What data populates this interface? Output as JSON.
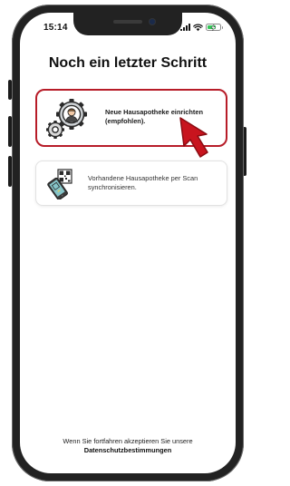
{
  "status_bar": {
    "time": "15:14",
    "icons": [
      "signal-icon",
      "wifi-icon",
      "battery-charging-icon"
    ],
    "battery_color": "#34c759",
    "battery_level": 0.7
  },
  "page": {
    "title": "Noch ein letzter Schritt"
  },
  "options": [
    {
      "label": "Neue Hausapotheke einrichten (empfohlen).",
      "icon": "gear-person-icon",
      "highlighted": true,
      "highlight_color": "#b71c28"
    },
    {
      "label": "Vorhandene Hausapotheke per Scan synchronisieren.",
      "icon": "qr-scan-phone-icon",
      "highlighted": false
    }
  ],
  "annotation": {
    "icon": "red-arrow-cursor-icon",
    "color": "#c8141e"
  },
  "footer": {
    "consent_text": "Wenn Sie fortfahren akzeptieren Sie unsere",
    "privacy_link": "Datenschutzbestimmungen"
  }
}
